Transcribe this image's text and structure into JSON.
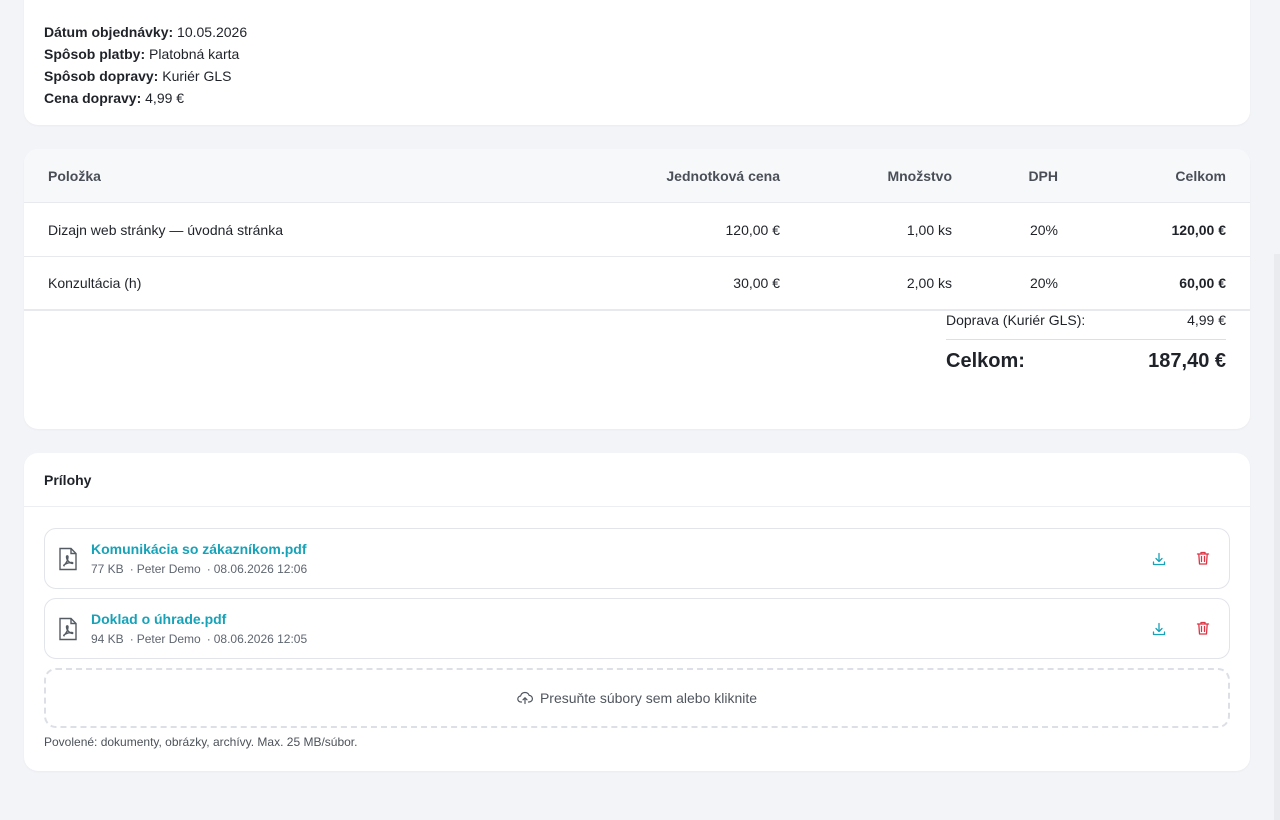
{
  "order_info": {
    "date_label": "Dátum objednávky:",
    "date_value": "10.05.2026",
    "payment_label": "Spôsob platby:",
    "payment_value": "Platobná karta",
    "shipping_label": "Spôsob dopravy:",
    "shipping_value": "Kuriér GLS",
    "shipping_price_label": "Cena dopravy:",
    "shipping_price_value": "4,99 €"
  },
  "items_table": {
    "headers": {
      "item": "Položka",
      "unit_price": "Jednotková cena",
      "quantity": "Množstvo",
      "vat": "DPH",
      "total": "Celkom"
    },
    "rows": [
      {
        "item": "Dizajn web stránky — úvodná stránka",
        "unit_price": "120,00 €",
        "quantity": "1,00 ks",
        "vat": "20%",
        "total": "120,00 €"
      },
      {
        "item": "Konzultácia (h)",
        "unit_price": "30,00 €",
        "quantity": "2,00 ks",
        "vat": "20%",
        "total": "60,00 €"
      }
    ],
    "shipping_label": "Doprava (Kuriér GLS):",
    "shipping_value": "4,99 €",
    "grand_total_label": "Celkom:",
    "grand_total_value": "187,40 €"
  },
  "attachments": {
    "title": "Prílohy",
    "files": [
      {
        "name": "Komunikácia so zákazníkom.pdf",
        "size": "77 KB",
        "author": "Peter Demo",
        "date": "08.06.2026 12:06",
        "icon": "pdf-file-icon"
      },
      {
        "name": "Doklad o úhrade.pdf",
        "size": "94 KB",
        "author": "Peter Demo",
        "date": "08.06.2026 12:05",
        "icon": "pdf-file-icon"
      }
    ],
    "dropzone_label": "Presuňte súbory sem alebo kliknite",
    "allowed_note": "Povolené: dokumenty, obrázky, archívy. Max. 25 MB/súbor."
  },
  "colors": {
    "accent": "#17a2b8",
    "danger": "#dc3545",
    "background": "#f3f4f8"
  }
}
